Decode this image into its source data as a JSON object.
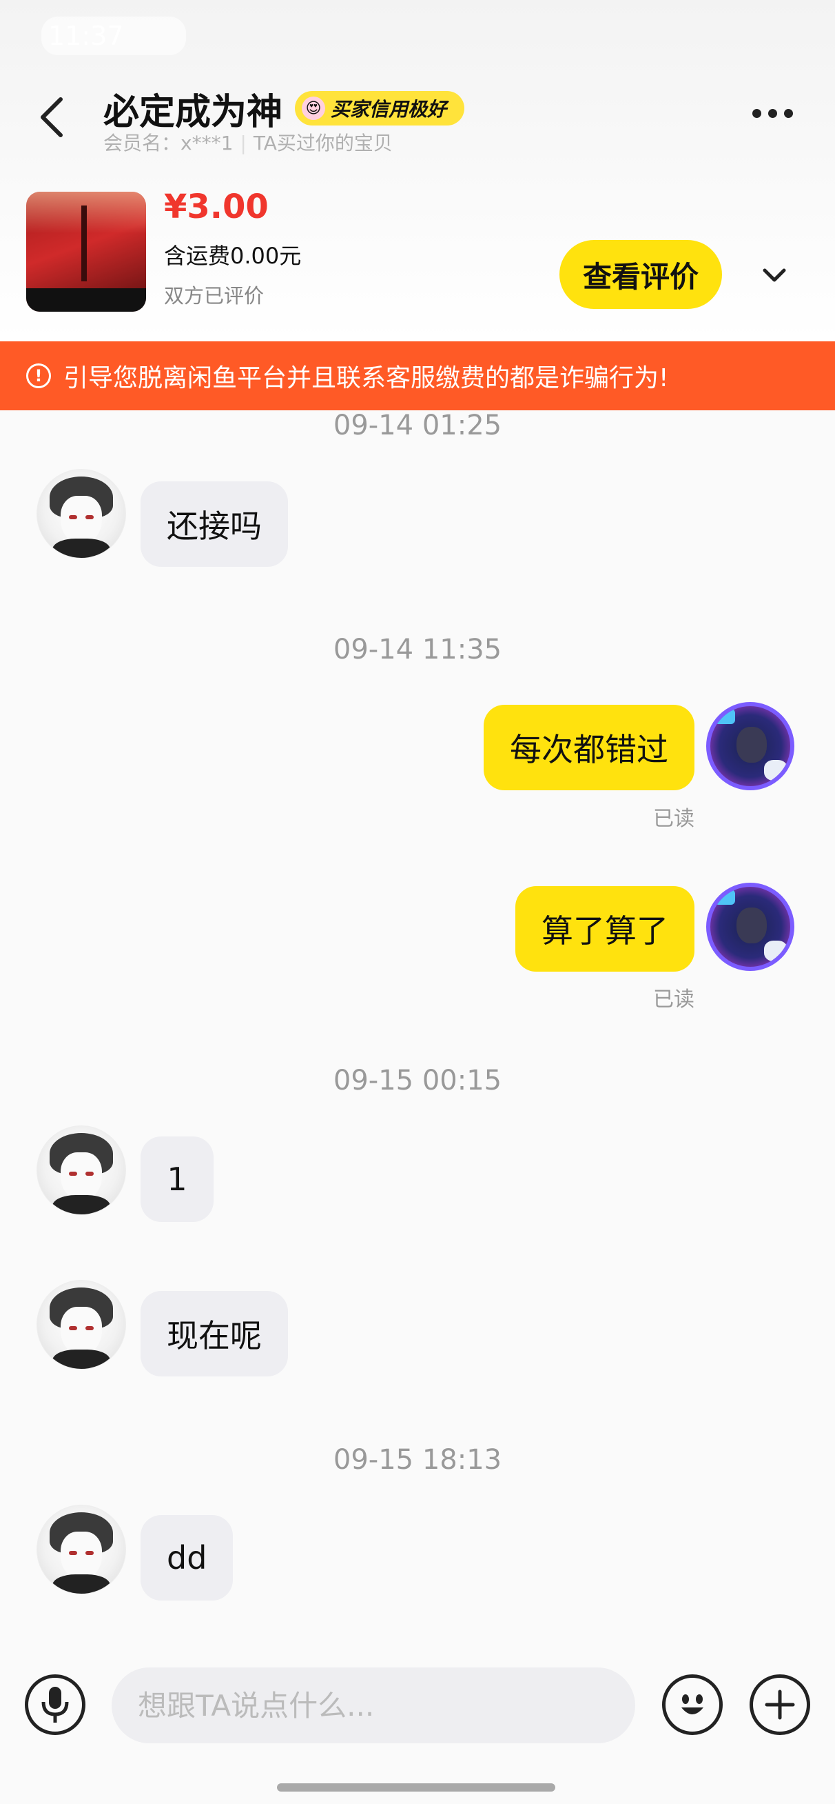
{
  "status_bar": {
    "time": "11:37"
  },
  "header": {
    "title": "必定成为神",
    "badge": "买家信用极好",
    "member_label": "会员名：",
    "member_name": "x***1",
    "relation": "TA买过你的宝贝"
  },
  "product": {
    "price": "¥3.00",
    "shipping": "含运费0.00元",
    "rating_status": "双方已评价",
    "review_button": "查看评价"
  },
  "warning": {
    "icon": "exclamation-circle-icon",
    "text": "引导您脱离闲鱼平台并且联系客服缴费的都是诈骗行为!"
  },
  "messages": [
    {
      "timestamp": "09-14 01:25"
    },
    {
      "side": "left",
      "text": "还接吗"
    },
    {
      "timestamp": "09-14 11:35"
    },
    {
      "side": "right",
      "text": "每次都错过",
      "status": "已读"
    },
    {
      "side": "right",
      "text": "算了算了",
      "status": "已读"
    },
    {
      "timestamp": "09-15 00:15"
    },
    {
      "side": "left",
      "text": "1"
    },
    {
      "side": "left",
      "text": "现在呢"
    },
    {
      "timestamp": "09-15 18:13"
    },
    {
      "side": "left",
      "text": "dd"
    }
  ],
  "input_bar": {
    "placeholder": "想跟TA说点什么...",
    "voice_icon": "microphone-icon",
    "emoji_icon": "smiley-icon",
    "add_icon": "plus-icon"
  },
  "colors": {
    "accent_yellow": "#ffe20e",
    "warning_orange": "#ff5a26",
    "price_red": "#f0362d"
  }
}
